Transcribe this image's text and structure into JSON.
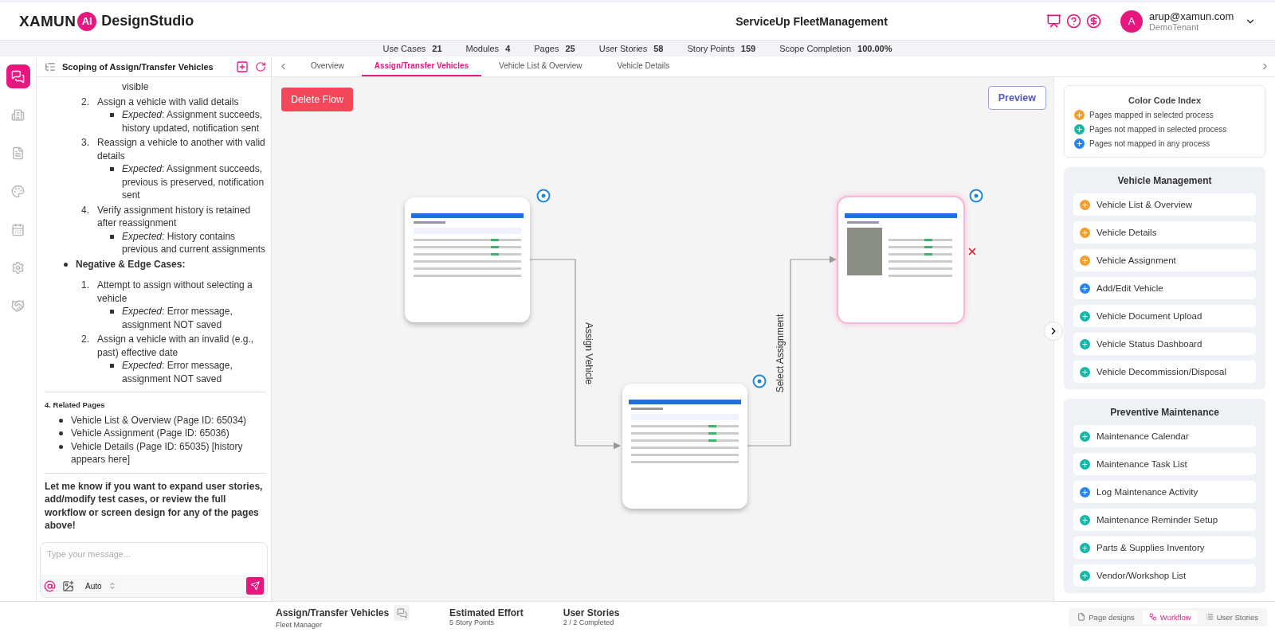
{
  "header": {
    "logo_main": "XAMUN",
    "logo_badge": "AI",
    "logo_suffix": "DesignStudio",
    "project_title": "ServiceUp FleetManagement",
    "user_initial": "A",
    "user_email": "arup@xamun.com",
    "user_tenant": "DemoTenant"
  },
  "stats": [
    {
      "label": "Use Cases",
      "value": "21"
    },
    {
      "label": "Modules",
      "value": "4"
    },
    {
      "label": "Pages",
      "value": "25"
    },
    {
      "label": "User Stories",
      "value": "58"
    },
    {
      "label": "Story Points",
      "value": "159"
    },
    {
      "label": "Scope Completion",
      "value": "100.00%"
    }
  ],
  "rail": [
    {
      "kind": "chat",
      "selected": true
    },
    {
      "kind": "building",
      "selected": false
    },
    {
      "kind": "document",
      "selected": false
    },
    {
      "kind": "palette",
      "selected": false
    },
    {
      "kind": "calendar",
      "selected": false
    },
    {
      "kind": "settings",
      "selected": false
    },
    {
      "kind": "handshake",
      "selected": false
    }
  ],
  "chat": {
    "title": "Scoping of Assign/Transfer Vehicles",
    "cut_fragment": "visible",
    "cases": [
      {
        "number": "2.",
        "text": "Assign a vehicle with valid details",
        "expected": "*Expected*: Assignment succeeds, history updated, notification sent"
      },
      {
        "number": "3.",
        "text": "Reassign a vehicle to another with valid details",
        "expected": "*Expected*: Assignment succeeds, previous is preserved, notification sent"
      },
      {
        "number": "4.",
        "text": "Verify assignment history is retained after reassignment",
        "expected": "*Expected*: History contains previous and current assignments"
      }
    ],
    "negative": {
      "heading": "Negative & Edge Cases:",
      "cases": [
        {
          "number": "1.",
          "text": "Attempt to assign without selecting a vehicle",
          "expected": "*Expected*: Error message, assignment NOT saved"
        },
        {
          "number": "2.",
          "text": "Assign a vehicle with an invalid (e.g., past) effective date",
          "expected": "*Expected*: Error message, assignment NOT saved"
        }
      ]
    },
    "related": {
      "heading": "4. Related Pages",
      "items": [
        "Vehicle List & Overview (Page ID: 65034)",
        "Vehicle Assignment (Page ID: 65036)",
        "Vehicle Details (Page ID: 65035) [history appears here]"
      ]
    },
    "closing": "Let me know if you want to expand user stories, add/modify test cases, or review the full workflow or screen design for any of the pages above!",
    "input": {
      "placeholder": "Type your message...",
      "model": "Auto"
    }
  },
  "tabs": [
    {
      "label": "Overview",
      "selected": false
    },
    {
      "label": "Assign/Transfer Vehicles",
      "selected": true
    },
    {
      "label": "Vehicle List & Overview",
      "selected": false
    },
    {
      "label": "Vehicle Details",
      "selected": false
    }
  ],
  "canvas": {
    "delete_button": "Delete Flow",
    "preview_button": "Preview",
    "nodes": [
      {
        "selected": false
      },
      {
        "selected": false
      },
      {
        "selected": true
      }
    ],
    "edges": [
      {
        "label": "Assign Vehicle"
      },
      {
        "label": "Select Assignment"
      }
    ]
  },
  "legend": {
    "title": "Color Code Index",
    "entries": [
      {
        "label": "Pages mapped in selected process",
        "color": "#f59e2b"
      },
      {
        "label": "Pages not mapped in selected process",
        "color": "#14b8a6"
      },
      {
        "label": "Pages not mapped in any process",
        "color": "#2684f5"
      }
    ]
  },
  "modules": [
    {
      "title": "Vehicle Management",
      "pages": [
        {
          "label": "Vehicle List & Overview",
          "color": "#f59e2b"
        },
        {
          "label": "Vehicle Details",
          "color": "#f59e2b"
        },
        {
          "label": "Vehicle Assignment",
          "color": "#f59e2b"
        },
        {
          "label": "Add/Edit Vehicle",
          "color": "#2684f5"
        },
        {
          "label": "Vehicle Document Upload",
          "color": "#14b8a6"
        },
        {
          "label": "Vehicle Status Dashboard",
          "color": "#14b8a6"
        },
        {
          "label": "Vehicle Decommission/Disposal",
          "color": "#14b8a6"
        }
      ]
    },
    {
      "title": "Preventive Maintenance",
      "pages": [
        {
          "label": "Maintenance Calendar",
          "color": "#14b8a6"
        },
        {
          "label": "Maintenance Task List",
          "color": "#14b8a6"
        },
        {
          "label": "Log Maintenance Activity",
          "color": "#2684f5"
        },
        {
          "label": "Maintenance Reminder Setup",
          "color": "#14b8a6"
        },
        {
          "label": "Parts & Supplies Inventory",
          "color": "#14b8a6"
        },
        {
          "label": "Vendor/Workshop List",
          "color": "#14b8a6"
        }
      ]
    }
  ],
  "footer": {
    "flow_title": "Assign/Transfer Vehicles",
    "role": "Fleet Manager",
    "effort_label": "Estimated Effort",
    "effort_value": "5 Story Points",
    "stories_label": "User Stories",
    "stories_value": "2 / 2 Completed",
    "views": [
      {
        "kind": "pages",
        "label": "Page designs",
        "selected": false
      },
      {
        "kind": "workflow",
        "label": "Workflow",
        "selected": true
      },
      {
        "kind": "stories",
        "label": "User Stories",
        "selected": false
      }
    ]
  }
}
